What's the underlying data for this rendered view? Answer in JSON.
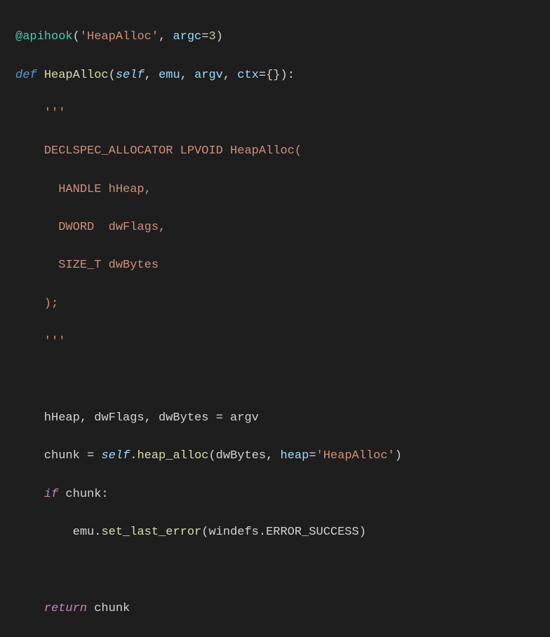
{
  "code": {
    "l1_dec": "@apihook",
    "l1_p1": "(",
    "l1_str": "'HeapAlloc'",
    "l1_comma": ", ",
    "l1_argc": "argc",
    "l1_eq": "=",
    "l1_num": "3",
    "l1_p2": ")",
    "l2_def": "def ",
    "l2_name": "HeapAlloc",
    "l2_p1": "(",
    "l2_self": "self",
    "l2_c1": ", ",
    "l2_emu": "emu",
    "l2_c2": ", ",
    "l2_argv": "argv",
    "l2_c3": ", ",
    "l2_ctx": "ctx",
    "l2_eq": "=",
    "l2_b1": "{}",
    "l2_p2": ")",
    "l2_colon": ":",
    "l3": "    '''",
    "l4": "    DECLSPEC_ALLOCATOR LPVOID HeapAlloc(",
    "l5": "      HANDLE hHeap,",
    "l6": "      DWORD  dwFlags,",
    "l7": "      SIZE_T dwBytes",
    "l8": "    );",
    "l9": "    '''",
    "bl1": " ",
    "l10_lhs": "    hHeap, dwFlags, dwBytes ",
    "l10_op": "=",
    "l10_rhs": " argv",
    "l11_chunk": "    chunk ",
    "l11_op": "=",
    "l11_sp": " ",
    "l11_self": "self",
    "l11_dot": ".",
    "l11_heap": "heap_alloc",
    "l11_p1": "(dwBytes, ",
    "l11_kwh": "heap",
    "l11_eq": "=",
    "l11_str": "'HeapAlloc'",
    "l11_p2": ")",
    "l12_if": "    if",
    "l12_cond": " chunk:",
    "l13_sp": "        ",
    "l13_emu": "emu.",
    "l13_m": "set_last_error",
    "l13_p1": "(windefs.ERROR_SUCCESS)",
    "bl2": " ",
    "l14_ret": "    return",
    "l14_v": " chunk"
  }
}
